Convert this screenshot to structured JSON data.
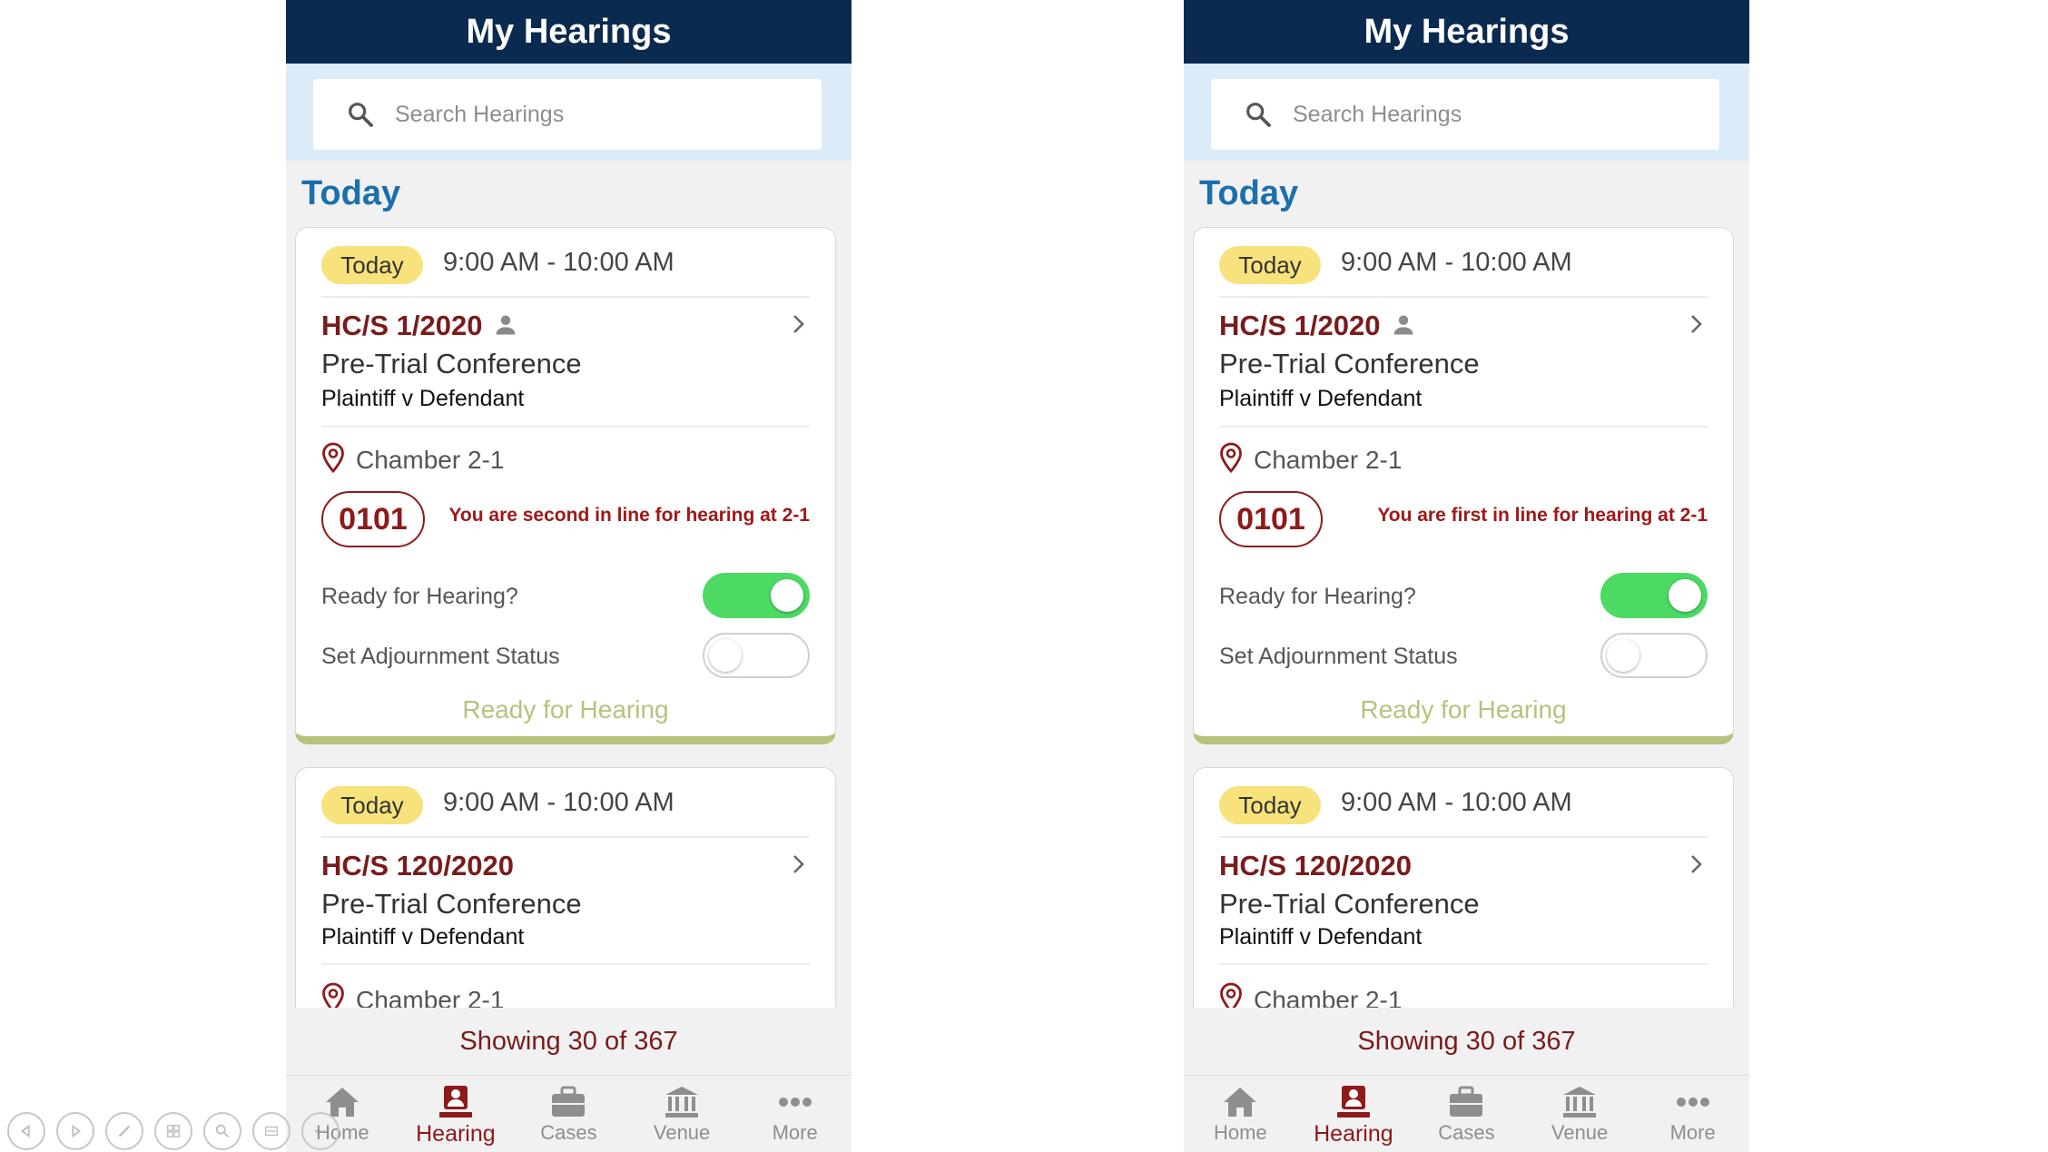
{
  "phones": [
    {
      "header_title": "My Hearings",
      "search_placeholder": "Search Hearings",
      "section_title": "Today",
      "cards": [
        {
          "badge": "Today",
          "time": "9:00 AM - 10:00 AM",
          "case_number": "HC/S 1/2020",
          "hearing_type": "Pre-Trial Conference",
          "parties": "Plaintiff v Defendant",
          "location": "Chamber 2-1",
          "queue_number": "0101",
          "queue_message": "You are second in line for hearing at 2-1",
          "ready_label": "Ready for Hearing?",
          "ready_on": true,
          "adjournment_label": "Set Adjournment Status",
          "adjournment_on": false,
          "status_text": "Ready for Hearing"
        },
        {
          "badge": "Today",
          "time": "9:00 AM - 10:00 AM",
          "case_number": "HC/S 120/2020",
          "hearing_type": "Pre-Trial Conference",
          "parties": "Plaintiff v Defendant",
          "location": "Chamber 2-1"
        }
      ],
      "showing_text": "Showing 30 of 367",
      "tabs": [
        {
          "label": "Home",
          "icon": "home-icon"
        },
        {
          "label": "Hearing",
          "icon": "hearing-icon",
          "active": true
        },
        {
          "label": "Cases",
          "icon": "briefcase-icon"
        },
        {
          "label": "Venue",
          "icon": "courthouse-icon"
        },
        {
          "label": "More",
          "icon": "more-dots-icon"
        }
      ]
    },
    {
      "header_title": "My Hearings",
      "search_placeholder": "Search Hearings",
      "section_title": "Today",
      "cards": [
        {
          "badge": "Today",
          "time": "9:00 AM - 10:00 AM",
          "case_number": "HC/S 1/2020",
          "hearing_type": "Pre-Trial Conference",
          "parties": "Plaintiff v Defendant",
          "location": "Chamber 2-1",
          "queue_number": "0101",
          "queue_message": "You are first in line for hearing at 2-1",
          "ready_label": "Ready for Hearing?",
          "ready_on": true,
          "adjournment_label": "Set Adjournment Status",
          "adjournment_on": false,
          "status_text": "Ready for Hearing"
        },
        {
          "badge": "Today",
          "time": "9:00 AM - 10:00 AM",
          "case_number": "HC/S 120/2020",
          "hearing_type": "Pre-Trial Conference",
          "parties": "Plaintiff v Defendant",
          "location": "Chamber 2-1"
        }
      ],
      "showing_text": "Showing 30 of 367",
      "tabs": [
        {
          "label": "Home",
          "icon": "home-icon"
        },
        {
          "label": "Hearing",
          "icon": "hearing-icon",
          "active": true
        },
        {
          "label": "Cases",
          "icon": "briefcase-icon"
        },
        {
          "label": "Venue",
          "icon": "courthouse-icon"
        },
        {
          "label": "More",
          "icon": "more-dots-icon"
        }
      ]
    }
  ],
  "colors": {
    "header": "#0b2a4f",
    "accent": "#8e1a1a",
    "toggle_on": "#4cd964",
    "ready_status": "#b7c27d",
    "today_badge": "#f7e27c",
    "section_title": "#1c6fad"
  },
  "slide_controls": [
    "previous-icon",
    "next-icon",
    "pen-icon",
    "slides-grid-icon",
    "zoom-icon",
    "subtitles-icon",
    "more-options-icon"
  ]
}
